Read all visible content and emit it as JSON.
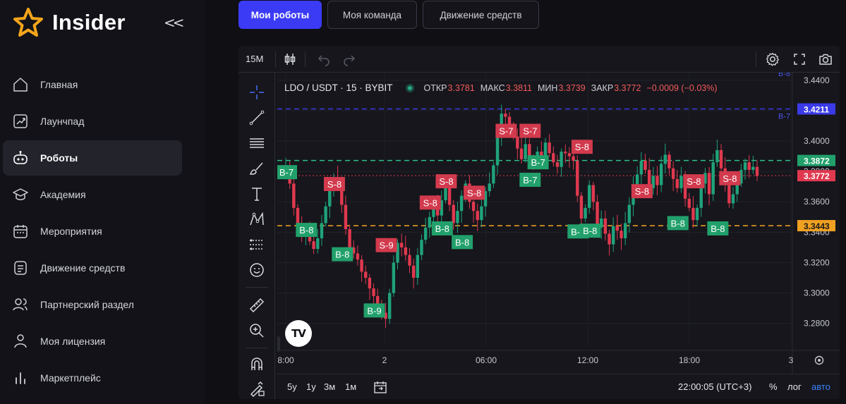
{
  "brand": {
    "name": "Insider",
    "collapse": "<<"
  },
  "nav": [
    {
      "label": "Главная",
      "icon": "home-icon"
    },
    {
      "label": "Лаунчпад",
      "icon": "launchpad-icon"
    },
    {
      "label": "Роботы",
      "icon": "robot-icon",
      "active": true
    },
    {
      "label": "Академия",
      "icon": "academy-icon"
    },
    {
      "label": "Мероприятия",
      "icon": "calendar-icon"
    },
    {
      "label": "Движение средств",
      "icon": "money-flow-icon"
    },
    {
      "label": "Партнерский раздел",
      "icon": "partners-icon"
    },
    {
      "label": "Моя лицензия",
      "icon": "license-icon"
    },
    {
      "label": "Маркетплейс",
      "icon": "marketplace-icon"
    }
  ],
  "tabs": [
    {
      "label": "Мои роботы",
      "active": true
    },
    {
      "label": "Моя команда"
    },
    {
      "label": "Движение средств"
    }
  ],
  "toolbar": {
    "timeframe": "15M"
  },
  "legend": {
    "symbol": "LDO / USDT · 15 · BYBIT",
    "open_label": "ОТКР",
    "open": "3.3781",
    "high_label": "МАКС",
    "high": "3.3811",
    "low_label": "МИН",
    "low": "3.3739",
    "close_label": "ЗАКР",
    "close": "3.3772",
    "change": "−0.0009 (−0.03%)"
  },
  "colors": {
    "up": "#1fa37a",
    "down": "#e0394f",
    "accent": "#3b3bf5",
    "line_blue": "#3a3ae8",
    "line_green": "#2fbf86",
    "line_orange": "#f5a623",
    "price_red": "#e0394f"
  },
  "chart_data": {
    "type": "candlestick",
    "symbol": "LDO / USDT",
    "interval": "15",
    "exchange": "BYBIT",
    "ylim": [
      3.265,
      3.445
    ],
    "y_ticks": [
      "3.4400",
      "3.4200",
      "3.4000",
      "3.3800",
      "3.3600",
      "3.3400",
      "3.3200",
      "3.3000",
      "3.2800"
    ],
    "x_ticks": [
      "8:00",
      "2",
      "06:00",
      "12:00",
      "18:00",
      "3"
    ],
    "horizontal_lines": [
      {
        "value": 3.4211,
        "label": "3.4211",
        "color": "#3a3ae8",
        "tag": "B-7"
      },
      {
        "value": 3.3872,
        "label": "3.3872",
        "color": "#2fbf86"
      },
      {
        "value": 3.3772,
        "label": "3.3772",
        "color": "#e0394f"
      },
      {
        "value": 3.3443,
        "label": "3.3443",
        "color": "#f5a623"
      }
    ],
    "closes": [
      3.384,
      3.372,
      3.356,
      3.345,
      3.338,
      3.341,
      3.334,
      3.329,
      3.336,
      3.346,
      3.357,
      3.368,
      3.376,
      3.372,
      3.358,
      3.342,
      3.33,
      3.326,
      3.322,
      3.314,
      3.31,
      3.303,
      3.298,
      3.29,
      3.287,
      3.283,
      3.3,
      3.32,
      3.333,
      3.33,
      3.325,
      3.318,
      3.31,
      3.325,
      3.335,
      3.343,
      3.35,
      3.357,
      3.351,
      3.361,
      3.369,
      3.358,
      3.346,
      3.354,
      3.364,
      3.372,
      3.36,
      3.354,
      3.348,
      3.357,
      3.367,
      3.372,
      3.384,
      3.404,
      3.418,
      3.416,
      3.41,
      3.403,
      3.395,
      3.388,
      3.398,
      3.389,
      3.385,
      3.393,
      3.389,
      3.399,
      3.392,
      3.386,
      3.383,
      3.393,
      3.392,
      3.39,
      3.387,
      3.364,
      3.349,
      3.356,
      3.371,
      3.36,
      3.343,
      3.349,
      3.339,
      3.332,
      3.344,
      3.341,
      3.336,
      3.346,
      3.358,
      3.37,
      3.378,
      3.387,
      3.381,
      3.369,
      3.377,
      3.371,
      3.385,
      3.391,
      3.382,
      3.375,
      3.369,
      3.377,
      3.362,
      3.356,
      3.348,
      3.356,
      3.372,
      3.379,
      3.365,
      3.386,
      3.394,
      3.382,
      3.372,
      3.359,
      3.365,
      3.372,
      3.381,
      3.386,
      3.381,
      3.383,
      3.377
    ],
    "signals": [
      {
        "label": "B-7",
        "side": "buy",
        "index": 0,
        "price": 3.3795
      },
      {
        "label": "B-8",
        "side": "buy",
        "index": 5,
        "price": 3.3415
      },
      {
        "label": "S-8",
        "side": "sell",
        "index": 12,
        "price": 3.3717
      },
      {
        "label": "B-8",
        "side": "buy",
        "index": 14,
        "price": 3.3255
      },
      {
        "label": "S-9",
        "side": "sell",
        "index": 25,
        "price": 3.3315
      },
      {
        "label": "B-9",
        "side": "buy",
        "index": 22,
        "price": 3.2885
      },
      {
        "label": "S-8",
        "side": "sell",
        "index": 36,
        "price": 3.3595
      },
      {
        "label": "B-8",
        "side": "buy",
        "index": 39,
        "price": 3.3425
      },
      {
        "label": "S-8",
        "side": "sell",
        "index": 40,
        "price": 3.3735
      },
      {
        "label": "B-8",
        "side": "buy",
        "index": 44,
        "price": 3.3335
      },
      {
        "label": "S-8",
        "side": "sell",
        "index": 47,
        "price": 3.366
      },
      {
        "label": "S-7",
        "side": "sell",
        "index": 55,
        "price": 3.4067
      },
      {
        "label": "S-7",
        "side": "sell",
        "index": 61,
        "price": 3.4067
      },
      {
        "label": "B-7",
        "side": "buy",
        "index": 63,
        "price": 3.386
      },
      {
        "label": "B-7",
        "side": "buy",
        "index": 61,
        "price": 3.3745
      },
      {
        "label": "S-8",
        "side": "sell",
        "index": 74,
        "price": 3.3962
      },
      {
        "label": "B-8",
        "side": "buy",
        "index": 73,
        "price": 3.3405
      },
      {
        "label": "B-8",
        "side": "buy",
        "index": 76,
        "price": 3.341
      },
      {
        "label": "S-8",
        "side": "sell",
        "index": 89,
        "price": 3.367
      },
      {
        "label": "B-8",
        "side": "buy",
        "index": 98,
        "price": 3.346
      },
      {
        "label": "S-8",
        "side": "sell",
        "index": 102,
        "price": 3.3735
      },
      {
        "label": "B-8",
        "side": "buy",
        "index": 108,
        "price": 3.3425
      },
      {
        "label": "S-8",
        "side": "sell",
        "index": 111,
        "price": 3.3755
      }
    ],
    "top_tag": "B-8"
  },
  "bottom": {
    "ranges": [
      "5y",
      "1y",
      "3м",
      "1м"
    ],
    "clock": "22:00:05 (UTC+3)",
    "percent": "%",
    "log": "лог",
    "auto": "авто"
  }
}
